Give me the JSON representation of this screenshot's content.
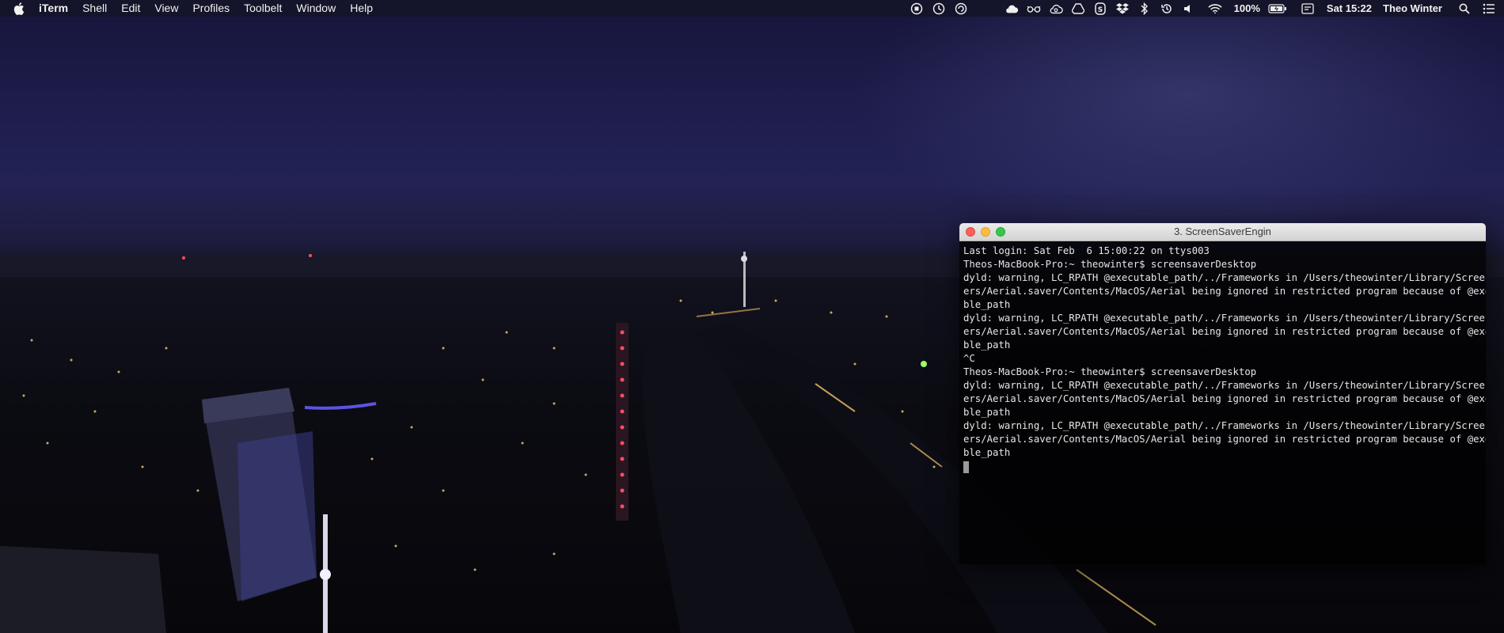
{
  "menubar": {
    "apple_icon": "apple-logo-icon",
    "app_name": "iTerm",
    "items": [
      "Shell",
      "Edit",
      "View",
      "Profiles",
      "Toolbelt",
      "Window",
      "Help"
    ],
    "status_icons": [
      "record-icon",
      "clock-icon",
      "refresh-icon",
      "cloud-icon",
      "glasses-icon",
      "creative-cloud-icon",
      "google-drive-icon",
      "s-circle-icon",
      "dropbox-icon",
      "bluetooth-icon",
      "time-machine-icon",
      "volume-icon",
      "wifi-icon"
    ],
    "battery_percent": "100%",
    "battery_icon": "battery-charging-icon",
    "input_icon": "keyboard-input-icon",
    "clock": "Sat 15:22",
    "user": "Theo Winter",
    "search_icon": "spotlight-search-icon",
    "notification_icon": "notification-center-icon"
  },
  "terminal": {
    "title": "3. ScreenSaverEngin",
    "lines": [
      "Last login: Sat Feb  6 15:00:22 on ttys003",
      "Theos-MacBook-Pro:~ theowinter$ screensaverDesktop",
      "dyld: warning, LC_RPATH @executable_path/../Frameworks in /Users/theowinter/Library/Screen Sav",
      "ers/Aerial.saver/Contents/MacOS/Aerial being ignored in restricted program because of @executa",
      "ble_path",
      "dyld: warning, LC_RPATH @executable_path/../Frameworks in /Users/theowinter/Library/Screen Sav",
      "ers/Aerial.saver/Contents/MacOS/Aerial being ignored in restricted program because of @executa",
      "ble_path",
      "^C",
      "Theos-MacBook-Pro:~ theowinter$ screensaverDesktop",
      "dyld: warning, LC_RPATH @executable_path/../Frameworks in /Users/theowinter/Library/Screen Sav",
      "ers/Aerial.saver/Contents/MacOS/Aerial being ignored in restricted program because of @executa",
      "ble_path",
      "dyld: warning, LC_RPATH @executable_path/../Frameworks in /Users/theowinter/Library/Screen Sav",
      "ers/Aerial.saver/Contents/MacOS/Aerial being ignored in restricted program because of @executa",
      "ble_path"
    ]
  },
  "colors": {
    "menubar_bg": "#14142a",
    "close": "#fc605c",
    "minimize": "#fdbc40",
    "maximize": "#34c84a"
  }
}
